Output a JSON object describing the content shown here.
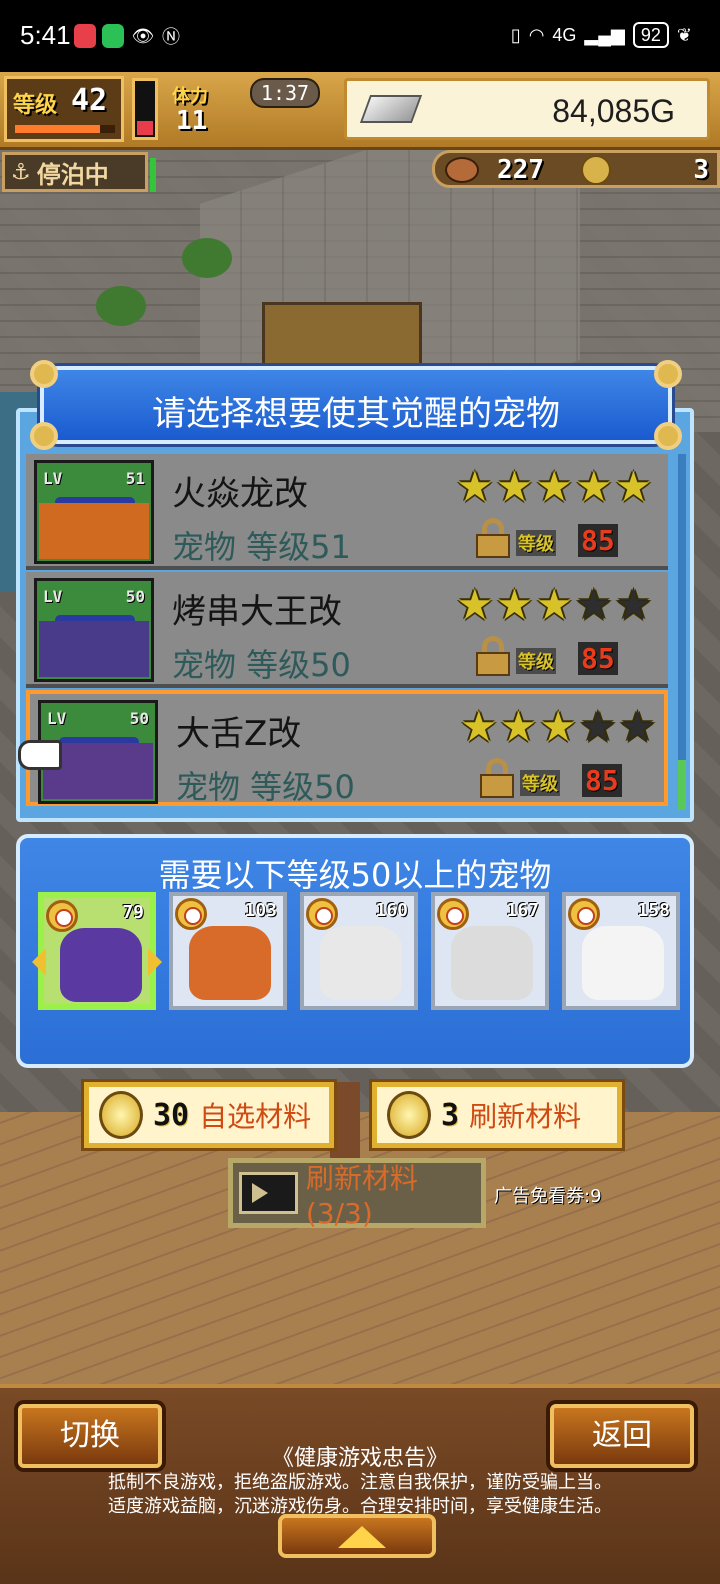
{
  "status_bar": {
    "time": "5:41",
    "battery": "92",
    "network": "4G"
  },
  "hud": {
    "level_label": "等级",
    "level": "42",
    "level_progress": 0.85,
    "stamina_label": "体力",
    "stamina": "11",
    "stamina_gauge": 0.25,
    "timer": "1:37",
    "gold": "84,085G",
    "state_badge": "停泊中",
    "food": "227",
    "coins": "3"
  },
  "panel": {
    "title": "请选择想要使其觉醒的宠物",
    "pets": [
      {
        "lv_label": "LV",
        "lv": "51",
        "name": "火焱龙改",
        "sub": "宠物 等级51",
        "stars": 5,
        "req_label": "等级",
        "req_level": "85",
        "thumb_color": "#3c8a3c",
        "art_color": "#d06a20"
      },
      {
        "lv_label": "LV",
        "lv": "50",
        "name": "烤串大王改",
        "sub": "宠物 等级50",
        "stars": 3,
        "req_label": "等级",
        "req_level": "85",
        "thumb_color": "#3c8a3c",
        "art_color": "#4a3a8a"
      },
      {
        "lv_label": "LV",
        "lv": "50",
        "name": "大舌Z改",
        "sub": "宠物 等级50",
        "stars": 3,
        "req_label": "等级",
        "req_level": "85",
        "thumb_color": "#3c8a3c",
        "art_color": "#5a3a8a"
      }
    ],
    "selected_index": 2
  },
  "materials": {
    "title": "需要以下等级50以上的宠物",
    "items": [
      {
        "num": "79",
        "art_color": "#5a3aa0",
        "selected": true
      },
      {
        "num": "103",
        "art_color": "#d86a2a",
        "selected": false
      },
      {
        "num": "160",
        "art_color": "#e8e8e8",
        "selected": false
      },
      {
        "num": "167",
        "art_color": "#dcdcdc",
        "selected": false
      },
      {
        "num": "158",
        "art_color": "#f4f4f4",
        "selected": false
      }
    ]
  },
  "actions": {
    "pick": {
      "count": "30",
      "label": "自选材料"
    },
    "refresh": {
      "count": "3",
      "label": "刷新材料"
    },
    "ad_refresh": {
      "label": "刷新材料(3/3)"
    },
    "ad_ticket": "广告免看券:9"
  },
  "bottom": {
    "switch_label": "切换",
    "back_label": "返回",
    "notice_title": "《健康游戏忠告》",
    "notice_line1": "抵制不良游戏，拒绝盗版游戏。注意自我保护，谨防受骗上当。",
    "notice_line2": "适度游戏益脑，沉迷游戏伤身。合理安排时间，享受健康生活。"
  }
}
